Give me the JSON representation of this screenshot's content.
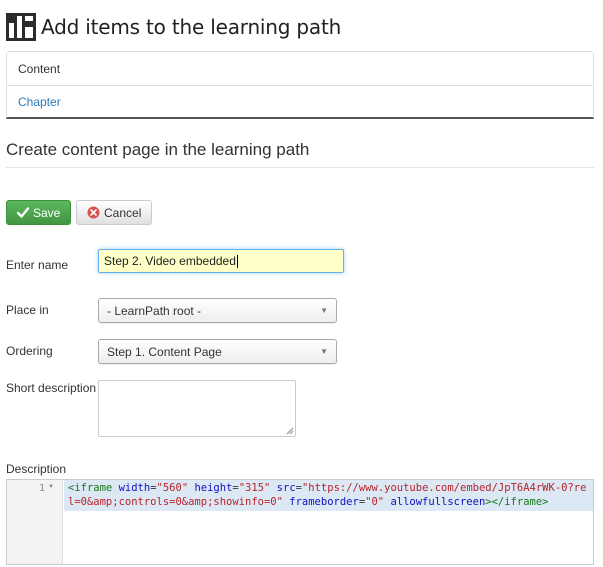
{
  "header": {
    "title": "Add items to the learning path",
    "logo_icon": "learnpath-logo-icon"
  },
  "items_panel": {
    "rows": [
      {
        "label": "Content",
        "link": false
      },
      {
        "label": "Chapter",
        "link": true
      }
    ]
  },
  "form": {
    "title": "Create content page in the learning path",
    "save_label": "Save",
    "cancel_label": "Cancel",
    "name_label": "Enter name",
    "name_value": "Step 2. Video embedded",
    "place_label": "Place in",
    "place_value": "- LearnPath root -",
    "ordering_label": "Ordering",
    "ordering_value": "Step 1. Content Page",
    "short_desc_label": "Short description",
    "short_desc_value": "",
    "description_label": "Description"
  },
  "editor": {
    "line_number": "1",
    "code": {
      "open_tag": "<iframe",
      "attrs": [
        {
          "name": "width",
          "value": "\"560\""
        },
        {
          "name": "height",
          "value": "\"315\""
        },
        {
          "name": "src",
          "value": "\"https://www.youtube.com/embed/JpT6A4rWK-0?rel=0&amp;controls=0&amp;showinfo=0\""
        },
        {
          "name": "frameborder",
          "value": "\"0\""
        },
        {
          "name": "allowfullscreen",
          "value": ""
        }
      ],
      "close": "></iframe>"
    }
  },
  "colors": {
    "save_green": "#5cb85c",
    "link_blue": "#2a7ab8",
    "input_focus_bg": "#ffffc8",
    "code_highlight_bg": "#dde8f5"
  }
}
